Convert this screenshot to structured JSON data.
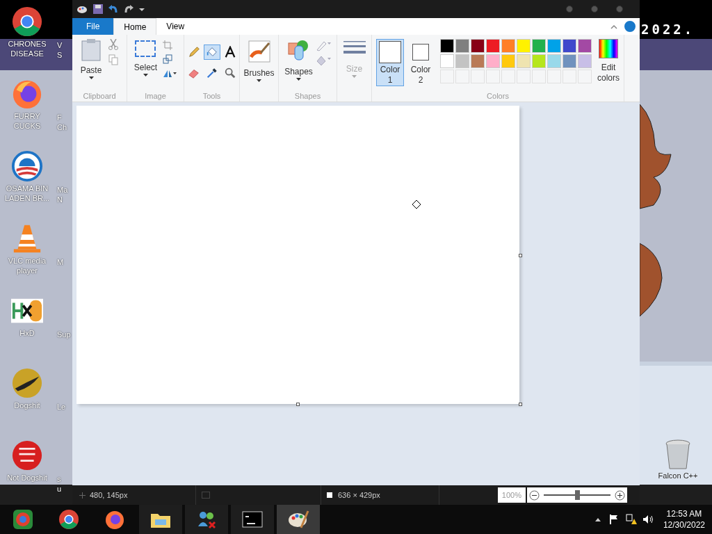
{
  "desktop": {
    "wallpaper_text": "2022.",
    "icons": [
      {
        "label": "CHRONES DISEASE",
        "kind": "chrome"
      },
      {
        "label": "FURRY CUCKS",
        "kind": "firefox"
      },
      {
        "label": "OSAMA BIN LADEN BR...",
        "kind": "rings"
      },
      {
        "label": "VLC media player",
        "kind": "cone"
      },
      {
        "label": "HxD",
        "kind": "hxd"
      },
      {
        "label": "Dogshit",
        "kind": "gold"
      },
      {
        "label": "Not Dogshit",
        "kind": "dev"
      }
    ],
    "partial_icons": [
      {
        "label": "V\nS"
      },
      {
        "label": "F\nCh"
      },
      {
        "label": "Ma\nN"
      },
      {
        "label": "M"
      },
      {
        "label": "Sup"
      },
      {
        "label": "Le"
      },
      {
        "label": "s\nu"
      }
    ],
    "right_icons": [
      {
        "label": "Falcon C++"
      }
    ]
  },
  "paint": {
    "tabs": [
      {
        "label": "File",
        "kind": "file",
        "selected": false
      },
      {
        "label": "Home",
        "kind": "tab",
        "selected": true
      },
      {
        "label": "View",
        "kind": "tab",
        "selected": false
      }
    ],
    "groups": {
      "clipboard": {
        "label": "Clipboard",
        "button": "Paste"
      },
      "image": {
        "label": "Image",
        "button": "Select"
      },
      "tools": {
        "label": "Tools",
        "items": [
          {
            "kind": "pencil",
            "selected": false
          },
          {
            "kind": "fill",
            "selected": true
          },
          {
            "kind": "text",
            "selected": false
          },
          {
            "kind": "eraser",
            "selected": false
          },
          {
            "kind": "picker",
            "selected": false
          },
          {
            "kind": "magnifier",
            "selected": false
          }
        ]
      },
      "brushes": {
        "button": "Brushes"
      },
      "shapes": {
        "label": "Shapes",
        "button": "Shapes"
      },
      "size": {
        "button": "Size",
        "disabled": true
      },
      "colors": {
        "label": "Colors",
        "slots": [
          {
            "label": "Color\n1",
            "color": "#ffffff",
            "selected": true
          },
          {
            "label": "Color\n2",
            "color": "#ffffff",
            "selected": false
          }
        ],
        "palette": [
          {
            "color": "#000000"
          },
          {
            "color": "#7f7f7f"
          },
          {
            "color": "#880015"
          },
          {
            "color": "#ed1c24"
          },
          {
            "color": "#ff7f27"
          },
          {
            "color": "#fff200"
          },
          {
            "color": "#22b14c"
          },
          {
            "color": "#00a2e8"
          },
          {
            "color": "#3f48cc"
          },
          {
            "color": "#a349a4"
          },
          {
            "color": "#ffffff"
          },
          {
            "color": "#c3c3c3"
          },
          {
            "color": "#b97a57"
          },
          {
            "color": "#ffaec9"
          },
          {
            "color": "#ffc90e"
          },
          {
            "color": "#efe4b0"
          },
          {
            "color": "#b5e61d"
          },
          {
            "color": "#99d9ea"
          },
          {
            "color": "#7092be"
          },
          {
            "color": "#c8bfe7"
          }
        ],
        "edit": "Edit\ncolors"
      }
    },
    "status": {
      "position": "480, 145px",
      "size": "636 × 429px",
      "zoom": "100%",
      "level": 0.5
    }
  },
  "taskbar": {
    "apps": [
      {
        "kind": "chromium",
        "selected": false
      },
      {
        "kind": "chrome",
        "selected": false
      },
      {
        "kind": "firefox",
        "selected": false
      },
      {
        "kind": "folder",
        "selected": false
      },
      {
        "kind": "people",
        "selected": false
      },
      {
        "kind": "console",
        "selected": false
      },
      {
        "kind": "paint",
        "selected": true
      }
    ],
    "time": "12:53 AM",
    "date": "12/30/2022"
  }
}
